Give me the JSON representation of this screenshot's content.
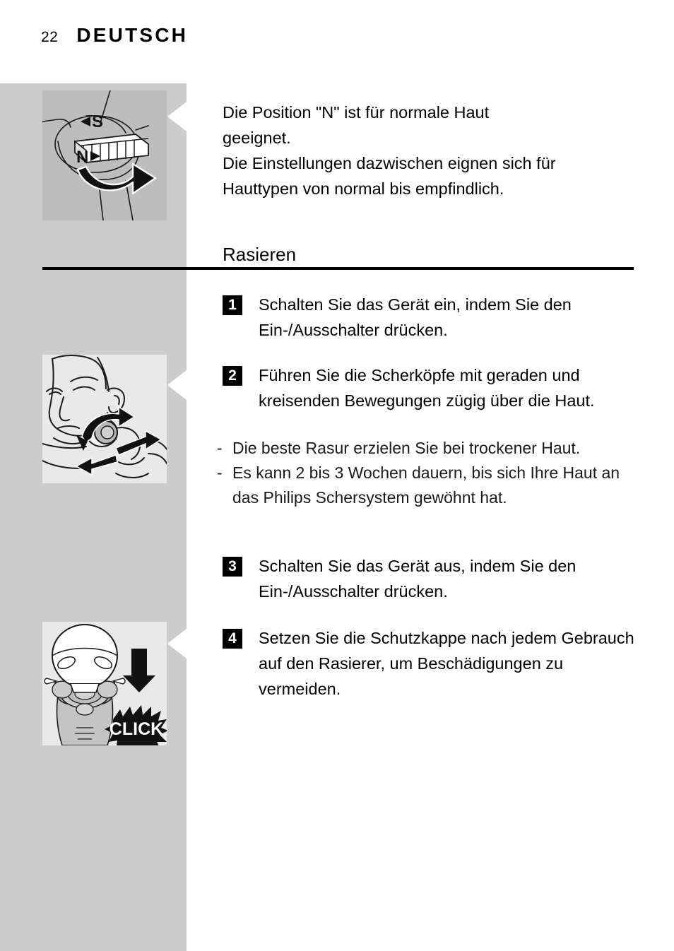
{
  "header": {
    "page_number": "22",
    "language_title": "DEUTSCH"
  },
  "intro": {
    "lines": [
      "Die Position \"N\" ist für normale Haut",
      "geeignet.",
      "Die Einstellungen dazwischen eignen sich für",
      "Hauttypen von normal bis empfindlich."
    ]
  },
  "section": {
    "heading": "Rasieren"
  },
  "steps": [
    {
      "number": "1",
      "text": "Schalten Sie das Gerät ein, indem Sie den Ein-/Ausschalter drücken."
    },
    {
      "number": "2",
      "text": "Führen Sie die Scherköpfe mit geraden und kreisenden Bewegungen zügig über die Haut."
    },
    {
      "number": "3",
      "text": "Schalten Sie das Gerät aus, indem Sie den Ein-/Ausschalter drücken."
    },
    {
      "number": "4",
      "text": "Setzen Sie die Schutzkappe nach jedem Gebrauch auf den Rasierer, um Beschädigungen zu vermeiden."
    }
  ],
  "bullets": [
    {
      "mark": "-",
      "text": "Die beste Rasur erzielen Sie bei trockener Haut."
    },
    {
      "mark": "-",
      "text": "Es kann 2 bis 3 Wochen dauern, bis sich Ihre Haut an das Philips Schersystem gewöhnt hat."
    }
  ],
  "illustrations": [
    {
      "name": "shaver-dial-setting",
      "labels": {
        "sensitive": "S",
        "normal": "N"
      }
    },
    {
      "name": "man-shaving-face",
      "labels": {}
    },
    {
      "name": "protection-cap-click",
      "labels": {
        "click": "CLICK"
      }
    }
  ],
  "colors": {
    "sidebar_gray": "#cccccc",
    "illustration_gray": "#bdbdbd",
    "illustration_light": "#e9e9e9",
    "text": "#000000"
  }
}
